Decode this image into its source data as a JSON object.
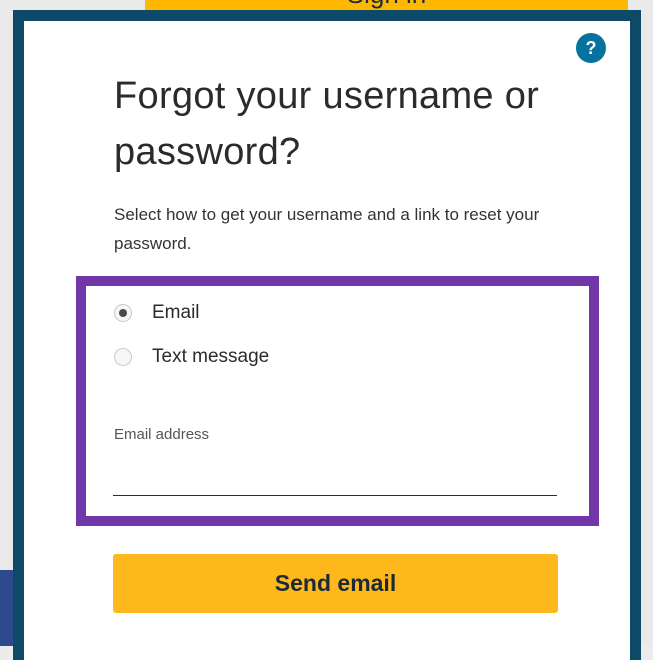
{
  "background": {
    "signin_label": "Sign in"
  },
  "dialog": {
    "help_icon": "question-mark-icon",
    "help_glyph": "?",
    "title": "Forgot your username or password?",
    "instructions": "Select how to get your username and a link to reset your password.",
    "options": [
      {
        "label": "Email",
        "selected": true
      },
      {
        "label": "Text message",
        "selected": false
      }
    ],
    "field": {
      "label": "Email address",
      "value": ""
    },
    "submit_label": "Send email"
  },
  "colors": {
    "modal_border": "#0c4a68",
    "help_icon": "#05739e",
    "highlight": "#7136a8",
    "button": "#ffb81c"
  }
}
